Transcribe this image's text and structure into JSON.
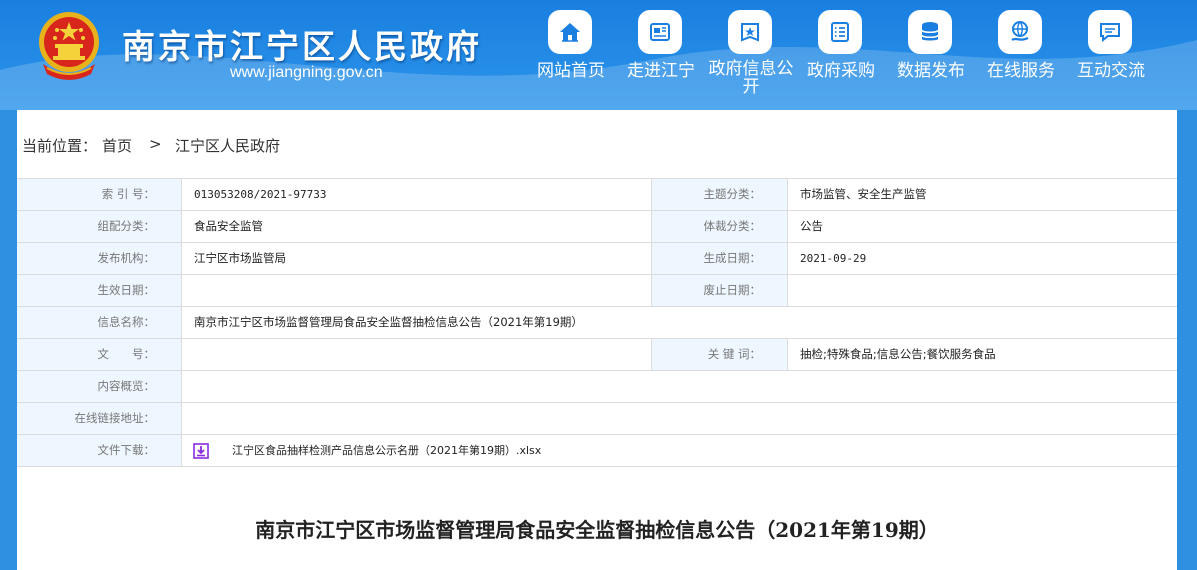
{
  "header": {
    "title": "南京市江宁区人民政府",
    "url": "www.jiangning.gov.cn",
    "nav": [
      {
        "label": "网站首页",
        "icon": "home-icon"
      },
      {
        "label": "走进江宁",
        "icon": "newspaper-icon"
      },
      {
        "label": "政府信息公开",
        "icon": "book-star-icon"
      },
      {
        "label": "政府采购",
        "icon": "list-icon"
      },
      {
        "label": "数据发布",
        "icon": "database-icon"
      },
      {
        "label": "在线服务",
        "icon": "globe-hand-icon"
      },
      {
        "label": "互动交流",
        "icon": "chat-icon"
      }
    ]
  },
  "breadcrumb": {
    "label": "当前位置：",
    "home": "首页",
    "separator": ">",
    "current": "江宁区人民政府"
  },
  "meta": {
    "index_label": "索 引 号：",
    "index_value": "013053208/2021-97733",
    "topic_label": "主题分类：",
    "topic_value": "市场监管、安全生产监管",
    "group_label": "组配分类：",
    "group_value": "食品安全监管",
    "genre_label": "体裁分类：",
    "genre_value": "公告",
    "publisher_label": "发布机构：",
    "publisher_value": "江宁区市场监管局",
    "created_label": "生成日期：",
    "created_value": "2021-09-29",
    "effective_label": "生效日期：",
    "effective_value": "",
    "expire_label": "废止日期：",
    "expire_value": "",
    "name_label": "信息名称：",
    "name_value": "南京市江宁区市场监督管理局食品安全监督抽检信息公告（2021年第19期）",
    "docno_label": "文　　号：",
    "docno_value": "",
    "keywords_label": "关 键 词：",
    "keywords_value": "抽检;特殊食品;信息公告;餐饮服务食品",
    "summary_label": "内容概览：",
    "summary_value": "",
    "link_label": "在线链接地址：",
    "link_value": "",
    "download_label": "文件下载：",
    "download_value": "江宁区食品抽样检测产品信息公示名册（2021年第19期）.xlsx"
  },
  "article": {
    "title": "南京市江宁区市场监督管理局食品安全监督抽检信息公告（2021年第19期）"
  },
  "colors": {
    "header_blue": "#1a7fe0",
    "label_bg": "#eef7ff",
    "download_icon": "#8a2be2"
  }
}
